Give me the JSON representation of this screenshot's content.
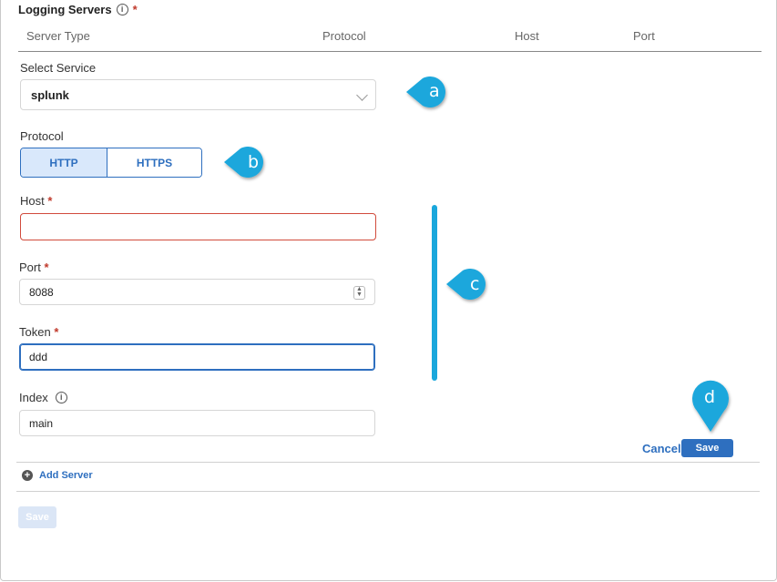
{
  "section": {
    "title": "Logging Servers",
    "info_icon": "i",
    "required_mark": "*"
  },
  "table_headers": [
    "Server Type",
    "Protocol",
    "Host",
    "Port"
  ],
  "select_service": {
    "label": "Select Service",
    "value": "splunk"
  },
  "protocol": {
    "label": "Protocol",
    "options": [
      "HTTP",
      "HTTPS"
    ],
    "selected": "HTTP"
  },
  "host": {
    "label": "Host",
    "required_mark": "*",
    "value": ""
  },
  "port": {
    "label": "Port",
    "required_mark": "*",
    "value": "8088"
  },
  "token": {
    "label": "Token",
    "required_mark": "*",
    "value": "ddd"
  },
  "index": {
    "label": "Index",
    "info_icon": "i",
    "value": "main"
  },
  "actions": {
    "cancel_label": "Cancel",
    "save_label": "Save"
  },
  "add_server": {
    "label": "Add Server",
    "icon": "+"
  },
  "footer": {
    "save_label": "Save"
  },
  "callouts": [
    "a",
    "b",
    "c",
    "d"
  ],
  "colors": {
    "accent": "#2e6fbf",
    "callout": "#1aa7dc",
    "error_border": "#d14b3c",
    "selected_bg": "#d9e8fb"
  }
}
